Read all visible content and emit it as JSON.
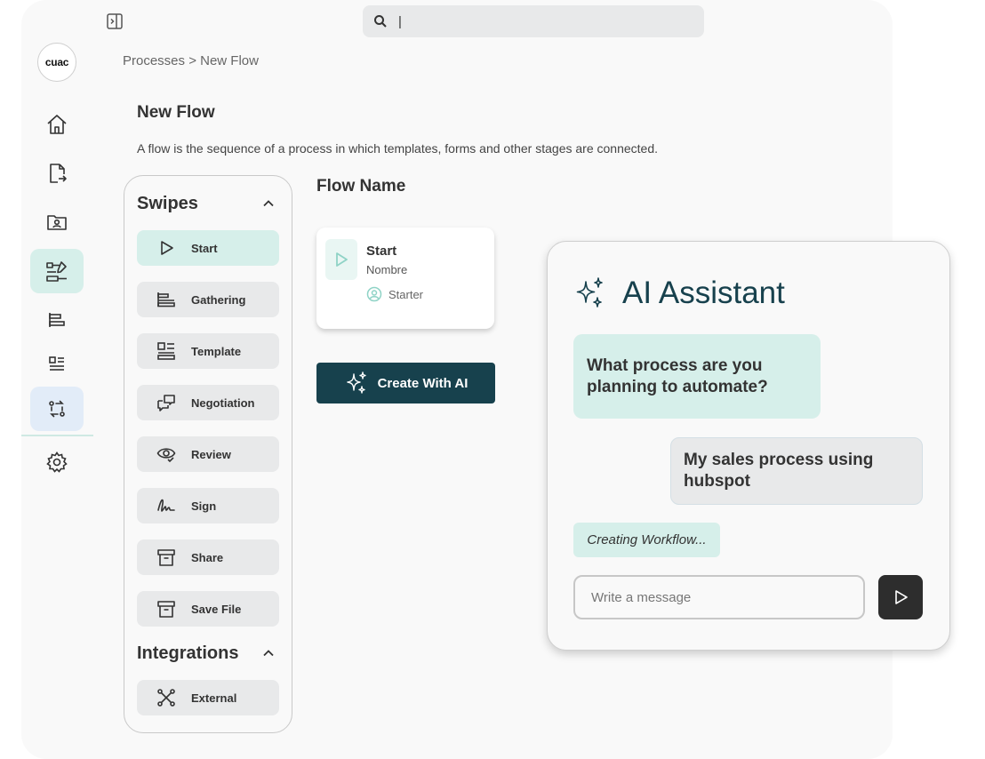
{
  "logo": {
    "text": "cuac"
  },
  "search": {
    "value": "|",
    "icon": "search-icon"
  },
  "breadcrumb": {
    "text": "Processes > New Flow"
  },
  "page": {
    "title": "New Flow",
    "description": "A flow is the sequence of a process in which templates, forms and other stages are connected."
  },
  "sidebar": {
    "items": [
      {
        "icon": "home-icon"
      },
      {
        "icon": "file-export-icon"
      },
      {
        "icon": "folder-user-icon"
      },
      {
        "icon": "flow-builder-icon",
        "active": true
      },
      {
        "icon": "align-left-icon"
      },
      {
        "icon": "template-list-icon"
      },
      {
        "icon": "convert-icon",
        "active": true
      },
      {
        "icon": "gear-icon"
      }
    ]
  },
  "swipes": {
    "title": "Swipes",
    "items": [
      {
        "label": "Start",
        "icon": "play-icon"
      },
      {
        "label": "Gathering",
        "icon": "align-left-icon"
      },
      {
        "label": "Template",
        "icon": "template-icon"
      },
      {
        "label": "Negotiation",
        "icon": "chat-icon"
      },
      {
        "label": "Review",
        "icon": "eye-icon"
      },
      {
        "label": "Sign",
        "icon": "signature-icon"
      },
      {
        "label": "Share",
        "icon": "archive-icon"
      },
      {
        "label": "Save File",
        "icon": "archive-icon"
      }
    ]
  },
  "integrations": {
    "title": "Integrations",
    "items": [
      {
        "label": "External",
        "icon": "network-icon"
      }
    ]
  },
  "flow": {
    "name_label": "Flow Name",
    "start_card": {
      "title": "Start",
      "subtitle": "Nombre",
      "role": "Starter"
    },
    "create_ai_label": "Create With AI"
  },
  "assistant": {
    "title": "AI Assistant",
    "bot_message": "What process are you planning to automate?",
    "user_message": "My sales process using hubspot",
    "status": "Creating Workflow...",
    "input_placeholder": "Write a message"
  },
  "colors": {
    "accent_green": "#d6efea",
    "dark_teal": "#17414d",
    "accent_blue": "#e2ecf8",
    "send_button": "#2d2d2d"
  }
}
